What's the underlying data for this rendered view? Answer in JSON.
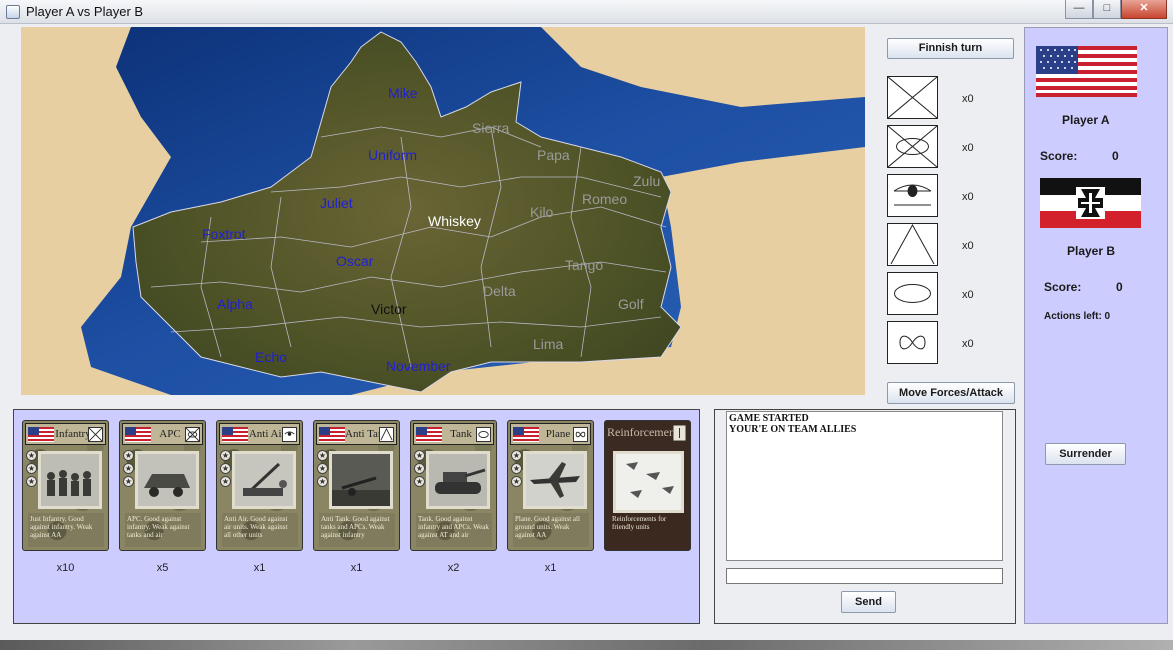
{
  "window": {
    "title": "Player A vs Player B"
  },
  "map": {
    "regions": [
      {
        "name": "Mike",
        "color": "#2020d0"
      },
      {
        "name": "Uniform",
        "color": "#2020d0"
      },
      {
        "name": "Juliet",
        "color": "#2020d0"
      },
      {
        "name": "Foxtrot",
        "color": "#2020d0"
      },
      {
        "name": "Oscar",
        "color": "#2020d0"
      },
      {
        "name": "Alpha",
        "color": "#2020d0"
      },
      {
        "name": "Echo",
        "color": "#2020d0"
      },
      {
        "name": "November",
        "color": "#2020d0"
      },
      {
        "name": "Whiskey",
        "color": "#ffffff"
      },
      {
        "name": "Victor",
        "color": "#111111"
      },
      {
        "name": "Sierra",
        "color": "#9a9a9a"
      },
      {
        "name": "Papa",
        "color": "#9a9a9a"
      },
      {
        "name": "Zulu",
        "color": "#9a9a9a"
      },
      {
        "name": "Kilo",
        "color": "#9a9a9a"
      },
      {
        "name": "Romeo",
        "color": "#9a9a9a"
      },
      {
        "name": "Tango",
        "color": "#9a9a9a"
      },
      {
        "name": "Delta",
        "color": "#9a9a9a"
      },
      {
        "name": "Golf",
        "color": "#9a9a9a"
      },
      {
        "name": "Lima",
        "color": "#9a9a9a"
      }
    ]
  },
  "controls": {
    "finish_turn": "Finnish turn",
    "move_attack": "Move Forces/Attack",
    "unit_types": [
      {
        "icon": "infantry-symbol-icon",
        "count": "x0"
      },
      {
        "icon": "apc-symbol-icon",
        "count": "x0"
      },
      {
        "icon": "anti-air-symbol-icon",
        "count": "x0"
      },
      {
        "icon": "anti-tank-symbol-icon",
        "count": "x0"
      },
      {
        "icon": "tank-symbol-icon",
        "count": "x0"
      },
      {
        "icon": "plane-symbol-icon",
        "count": "x0"
      }
    ]
  },
  "players": {
    "a": {
      "name": "Player A",
      "score_label": "Score:",
      "score": "0"
    },
    "b": {
      "name": "Player B",
      "score_label": "Score:",
      "score": "0",
      "actions": "Actions left: 0"
    },
    "surrender": "Surrender"
  },
  "cards": [
    {
      "name": "Infantry",
      "symbol": "infantry-symbol-icon",
      "desc": "Just Infantry. Good against infantry. Weak against AA",
      "count": "x10"
    },
    {
      "name": "APC",
      "symbol": "apc-symbol-icon",
      "desc": "APC. Good against infantry. Weak against tanks and air",
      "count": "x5"
    },
    {
      "name": "Anti Air",
      "symbol": "anti-air-symbol-icon",
      "desc": "Anti Air. Good against air units. Weak against all other units",
      "count": "x1"
    },
    {
      "name": "Anti Tank",
      "symbol": "anti-tank-symbol-icon",
      "desc": "Anti Tank. Good against tanks and APCs. Weak against infantry",
      "count": "x1"
    },
    {
      "name": "Tank",
      "symbol": "tank-symbol-icon",
      "desc": "Tank. Good against infantry and APCs. Weak against AT and air",
      "count": "x2"
    },
    {
      "name": "Plane",
      "symbol": "plane-symbol-icon",
      "desc": "Plane. Good against all ground units. Weak against AA",
      "count": "x1"
    },
    {
      "name": "Reinforcements",
      "symbol": "reinforcement-symbol-icon",
      "desc": "Reinforcements for friendly units",
      "count": ""
    }
  ],
  "chat": {
    "lines": [
      "GAME STARTED",
      "YOUR'E ON TEAM ALLIES"
    ],
    "input_value": "",
    "send": "Send"
  },
  "colors": {
    "panel": "#ccccfe",
    "sea": "#1d4fa3",
    "land": "#e8cfa2",
    "playable_land": "#4a4d25"
  }
}
